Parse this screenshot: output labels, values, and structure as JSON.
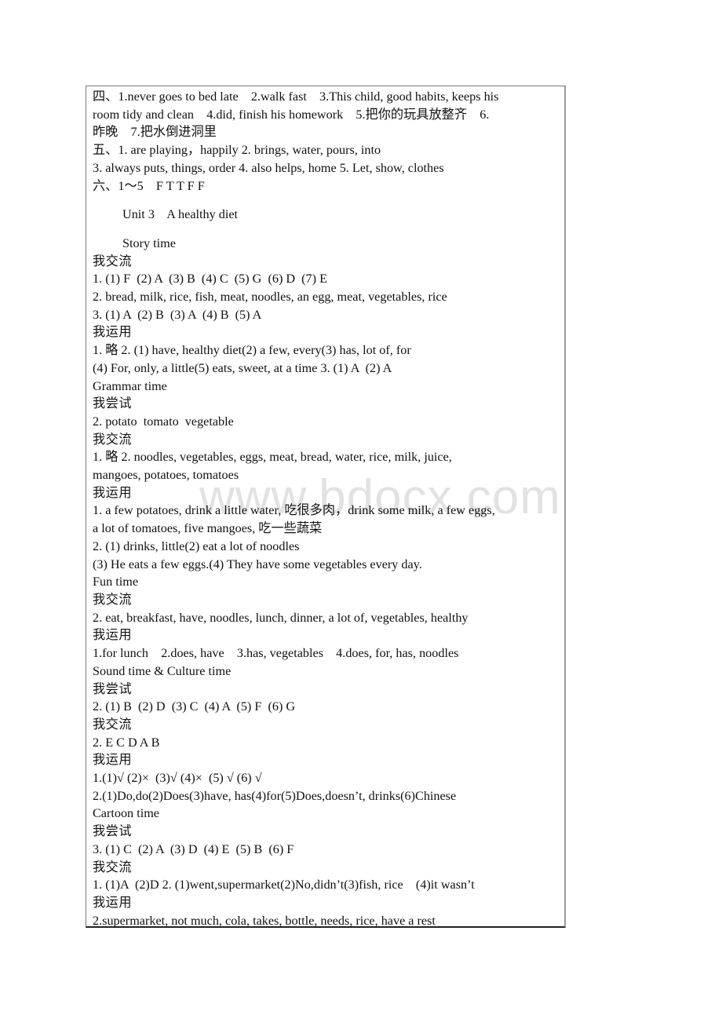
{
  "watermark": "www.bdocx.com",
  "lines": {
    "l01": "四、1.never goes to bed late    2.walk fast    3.This child, good habits, keeps his",
    "l02": "room tidy and clean    4.did, finish his homework    5.把你的玩具放整齐    6.",
    "l03": "昨晚    7.把水倒进洞里",
    "l04": "五、1. are playing，happily 2. brings, water, pours, into",
    "l05": "3. always puts, things, order 4. also helps, home 5. Let, show, clothes",
    "l06": "六、1～5    F T T F F",
    "l07": "Unit 3    A healthy diet",
    "l08": "Story time",
    "l09": "我交流",
    "l10": "1. (1) F  (2) A  (3) B  (4) C  (5) G  (6) D  (7) E",
    "l11": "2. bread, milk, rice, fish, meat, noodles, an egg, meat, vegetables, rice",
    "l12": "3. (1) A  (2) B  (3) A  (4) B  (5) A",
    "l13": "我运用",
    "l14": "1. 略 2. (1) have, healthy diet(2) a few, every(3) has, lot of, for",
    "l15": "(4) For, only, a little(5) eats, sweet, at a time 3. (1) A  (2) A",
    "l16": "Grammar time",
    "l17": "我尝试",
    "l18": "2. potato  tomato  vegetable",
    "l19": "我交流",
    "l20": "1. 略 2. noodles, vegetables, eggs, meat, bread, water, rice, milk, juice,",
    "l21": "mangoes, potatoes, tomatoes",
    "l22": "我运用",
    "l23": "1. a few potatoes, drink a little water, 吃很多肉，drink some milk, a few eggs,",
    "l24": "a lot of tomatoes, five mangoes, 吃一些蔬菜",
    "l25": "2. (1) drinks, little(2) eat a lot of noodles",
    "l26": "(3) He eats a few eggs.(4) They have some vegetables every day.",
    "l27": "Fun time",
    "l28": "我交流",
    "l29": "2. eat, breakfast, have, noodles, lunch, dinner, a lot of, vegetables, healthy",
    "l30": "我运用",
    "l31": "1.for lunch    2.does, have    3.has, vegetables    4.does, for, has, noodles",
    "l32": "Sound time & Culture time",
    "l33": "我尝试",
    "l34": "2. (1) B  (2) D  (3) C  (4) A  (5) F  (6) G",
    "l35": "我交流",
    "l36": "2. E C D A B",
    "l37": "我运用",
    "l38": "1.(1)√ (2)×  (3)√ (4)×  (5) √ (6) √",
    "l39": "2.(1)Do,do(2)Does(3)have, has(4)for(5)Does,doesn’t, drinks(6)Chinese",
    "l40": "Cartoon time",
    "l41": "我尝试",
    "l42": "3. (1) C  (2) A  (3) D  (4) E  (5) B  (6) F",
    "l43": "我交流",
    "l44": "1. (1)A  (2)D 2. (1)went,supermarket(2)No,didn’t(3)fish, rice    (4)it wasn’t",
    "l45": "我运用",
    "l46": "2.supermarket, not much, cola, takes, bottle, needs, rice, have a rest"
  }
}
